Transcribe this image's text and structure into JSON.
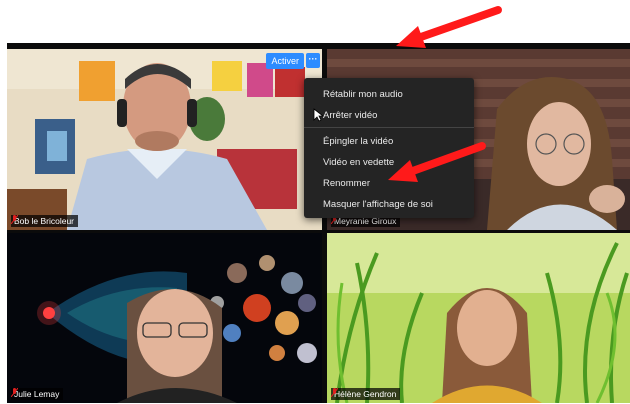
{
  "participants": [
    {
      "name": "Bob le Bricoleur"
    },
    {
      "name": "Meyranie Giroux"
    },
    {
      "name": "Julie Lemay"
    },
    {
      "name": "Hélène Gendron"
    }
  ],
  "tile_controls": {
    "activer_label": "Activer",
    "more_label": "···"
  },
  "context_menu": {
    "items": [
      "Rétablir mon audio",
      "Arrêter vidéo",
      "Épingler la vidéo",
      "Vidéo en vedette",
      "Renommer",
      "Masquer l'affichage de soi"
    ]
  },
  "icons": {
    "mic": "muted-mic-icon",
    "cursor": "mouse-pointer-icon",
    "annotation": "red-arrow"
  },
  "colors": {
    "accent": "#2d8cff",
    "menu_bg": "#242424",
    "annotation": "#ff1a1a",
    "muted_mic": "#e02020"
  }
}
